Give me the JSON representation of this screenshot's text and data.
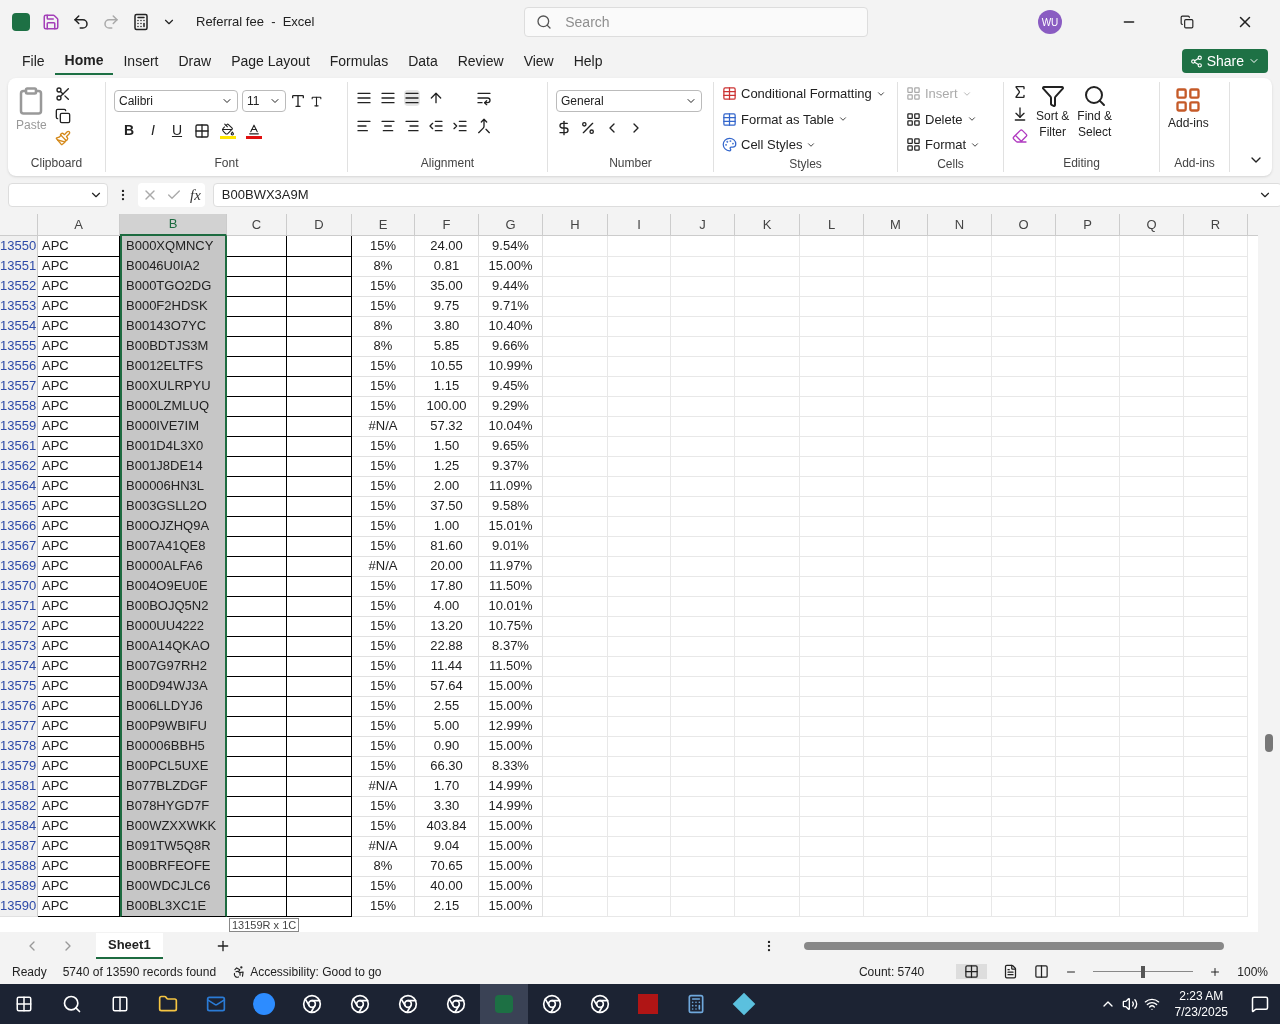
{
  "title_bar": {
    "title": "Referral fee  -  Excel",
    "search_placeholder": "Search",
    "avatar": "WU"
  },
  "menu_tabs": [
    {
      "label": "File",
      "selected": false
    },
    {
      "label": "Home",
      "selected": true
    },
    {
      "label": "Insert",
      "selected": false
    },
    {
      "label": "Draw",
      "selected": false
    },
    {
      "label": "Page Layout",
      "selected": false
    },
    {
      "label": "Formulas",
      "selected": false
    },
    {
      "label": "Data",
      "selected": false
    },
    {
      "label": "Review",
      "selected": false
    },
    {
      "label": "View",
      "selected": false
    },
    {
      "label": "Help",
      "selected": false
    }
  ],
  "share": "Share",
  "ribbon": {
    "clipboard": {
      "label": "Clipboard",
      "paste": "Paste"
    },
    "font": {
      "label": "Font",
      "font_name": "Calibri",
      "font_size": "11",
      "styles": [
        "B",
        "I",
        "U"
      ]
    },
    "alignment": {
      "label": "Alignment"
    },
    "number": {
      "label": "Number",
      "format": "General"
    },
    "styles": {
      "label": "Styles",
      "buttons": [
        "Conditional Formatting",
        "Format as Table",
        "Cell Styles"
      ]
    },
    "cells": {
      "label": "Cells",
      "buttons": [
        {
          "label": "Insert",
          "disabled": true
        },
        {
          "label": "Delete",
          "disabled": false
        },
        {
          "label": "Format",
          "disabled": false
        }
      ]
    },
    "editing": {
      "label": "Editing",
      "sort": [
        "Sort &",
        "Filter"
      ],
      "find": [
        "Find &",
        "Select"
      ]
    },
    "addins": {
      "label": "Add-ins",
      "button": "Add-ins"
    }
  },
  "formula_bar": {
    "function_label": "fx",
    "value": "B00BWX3A9M"
  },
  "columns": [
    {
      "label": "A",
      "selected": false
    },
    {
      "label": "B",
      "selected": true
    },
    {
      "label": "C",
      "selected": false
    },
    {
      "label": "D",
      "selected": false
    },
    {
      "label": "E",
      "selected": false
    },
    {
      "label": "F",
      "selected": false
    },
    {
      "label": "G",
      "selected": false
    },
    {
      "label": "H",
      "selected": false
    },
    {
      "label": "I",
      "selected": false
    },
    {
      "label": "J",
      "selected": false
    },
    {
      "label": "K",
      "selected": false
    },
    {
      "label": "L",
      "selected": false
    },
    {
      "label": "M",
      "selected": false
    },
    {
      "label": "N",
      "selected": false
    },
    {
      "label": "O",
      "selected": false
    },
    {
      "label": "P",
      "selected": false
    },
    {
      "label": "Q",
      "selected": false
    },
    {
      "label": "R",
      "selected": false
    }
  ],
  "rows": [
    {
      "row": "13550",
      "a": "APC",
      "b": "B000XQMNCY",
      "e": "15%",
      "f": "24.00",
      "g": "9.54%"
    },
    {
      "row": "13551",
      "a": "APC",
      "b": "B0046U0IA2",
      "e": "8%",
      "f": "0.81",
      "g": "15.00%"
    },
    {
      "row": "13552",
      "a": "APC",
      "b": "B000TGO2DG",
      "e": "15%",
      "f": "35.00",
      "g": "9.44%"
    },
    {
      "row": "13553",
      "a": "APC",
      "b": "B000F2HDSK",
      "e": "15%",
      "f": "9.75",
      "g": "9.71%"
    },
    {
      "row": "13554",
      "a": "APC",
      "b": "B00143O7YC",
      "e": "8%",
      "f": "3.80",
      "g": "10.40%"
    },
    {
      "row": "13555",
      "a": "APC",
      "b": "B00BDTJS3M",
      "e": "8%",
      "f": "5.85",
      "g": "9.66%"
    },
    {
      "row": "13556",
      "a": "APC",
      "b": "B0012ELTFS",
      "e": "15%",
      "f": "10.55",
      "g": "10.99%"
    },
    {
      "row": "13557",
      "a": "APC",
      "b": "B00XULRPYU",
      "e": "15%",
      "f": "1.15",
      "g": "9.45%"
    },
    {
      "row": "13558",
      "a": "APC",
      "b": "B000LZMLUQ",
      "e": "15%",
      "f": "100.00",
      "g": "9.29%"
    },
    {
      "row": "13559",
      "a": "APC",
      "b": "B000IVE7IM",
      "e": "#N/A",
      "f": "57.32",
      "g": "10.04%"
    },
    {
      "row": "13561",
      "a": "APC",
      "b": "B001D4L3X0",
      "e": "15%",
      "f": "1.50",
      "g": "9.65%"
    },
    {
      "row": "13562",
      "a": "APC",
      "b": "B001J8DE14",
      "e": "15%",
      "f": "1.25",
      "g": "9.37%"
    },
    {
      "row": "13564",
      "a": "APC",
      "b": "B00006HN3L",
      "e": "15%",
      "f": "2.00",
      "g": "11.09%"
    },
    {
      "row": "13565",
      "a": "APC",
      "b": "B003GSLL2O",
      "e": "15%",
      "f": "37.50",
      "g": "9.58%"
    },
    {
      "row": "13566",
      "a": "APC",
      "b": "B00OJZHQ9A",
      "e": "15%",
      "f": "1.00",
      "g": "15.01%"
    },
    {
      "row": "13567",
      "a": "APC",
      "b": "B007A41QE8",
      "e": "15%",
      "f": "81.60",
      "g": "9.01%"
    },
    {
      "row": "13569",
      "a": "APC",
      "b": "B0000ALFA6",
      "e": "#N/A",
      "f": "20.00",
      "g": "11.97%"
    },
    {
      "row": "13570",
      "a": "APC",
      "b": "B004O9EU0E",
      "e": "15%",
      "f": "17.80",
      "g": "11.50%"
    },
    {
      "row": "13571",
      "a": "APC",
      "b": "B00BOJQ5N2",
      "e": "15%",
      "f": "4.00",
      "g": "10.01%"
    },
    {
      "row": "13572",
      "a": "APC",
      "b": "B000UU4222",
      "e": "15%",
      "f": "13.20",
      "g": "10.75%"
    },
    {
      "row": "13573",
      "a": "APC",
      "b": "B00A14QKAO",
      "e": "15%",
      "f": "22.88",
      "g": "8.37%"
    },
    {
      "row": "13574",
      "a": "APC",
      "b": "B007G97RH2",
      "e": "15%",
      "f": "11.44",
      "g": "11.50%"
    },
    {
      "row": "13575",
      "a": "APC",
      "b": "B00D94WJ3A",
      "e": "15%",
      "f": "57.64",
      "g": "15.00%"
    },
    {
      "row": "13576",
      "a": "APC",
      "b": "B006LLDYJ6",
      "e": "15%",
      "f": "2.55",
      "g": "15.00%"
    },
    {
      "row": "13577",
      "a": "APC",
      "b": "B00P9WBIFU",
      "e": "15%",
      "f": "5.00",
      "g": "12.99%"
    },
    {
      "row": "13578",
      "a": "APC",
      "b": "B00006BBH5",
      "e": "15%",
      "f": "0.90",
      "g": "15.00%"
    },
    {
      "row": "13579",
      "a": "APC",
      "b": "B00PCL5UXE",
      "e": "15%",
      "f": "66.30",
      "g": "8.33%"
    },
    {
      "row": "13581",
      "a": "APC",
      "b": "B077BLZDGF",
      "e": "#N/A",
      "f": "1.70",
      "g": "14.99%"
    },
    {
      "row": "13582",
      "a": "APC",
      "b": "B078HYGD7F",
      "e": "15%",
      "f": "3.30",
      "g": "14.99%"
    },
    {
      "row": "13584",
      "a": "APC",
      "b": "B00WZXXWKK",
      "e": "15%",
      "f": "403.84",
      "g": "15.00%"
    },
    {
      "row": "13587",
      "a": "APC",
      "b": "B091TW5Q8R",
      "e": "#N/A",
      "f": "9.04",
      "g": "15.00%"
    },
    {
      "row": "13588",
      "a": "APC",
      "b": "B00BRFEOFE",
      "e": "8%",
      "f": "70.65",
      "g": "15.00%"
    },
    {
      "row": "13589",
      "a": "APC",
      "b": "B00WDCJLC6",
      "e": "15%",
      "f": "40.00",
      "g": "15.00%"
    },
    {
      "row": "13590",
      "a": "APC",
      "b": "B00BL3XC1E",
      "e": "15%",
      "f": "2.15",
      "g": "15.00%"
    }
  ],
  "selection_tooltip": "13159R x 1C",
  "sheet_tabs": [
    {
      "label": "Sheet1",
      "selected": true
    }
  ],
  "status_bar": {
    "mode": "Ready",
    "records": "5740 of 13590 records found",
    "accessibility": "Accessibility: Good to go",
    "count": "Count: 5740",
    "zoom": "100%",
    "zoom_slider": {
      "level": 0.5
    }
  },
  "taskbar": {
    "time": "2:23 AM",
    "date": "7/23/2025"
  }
}
